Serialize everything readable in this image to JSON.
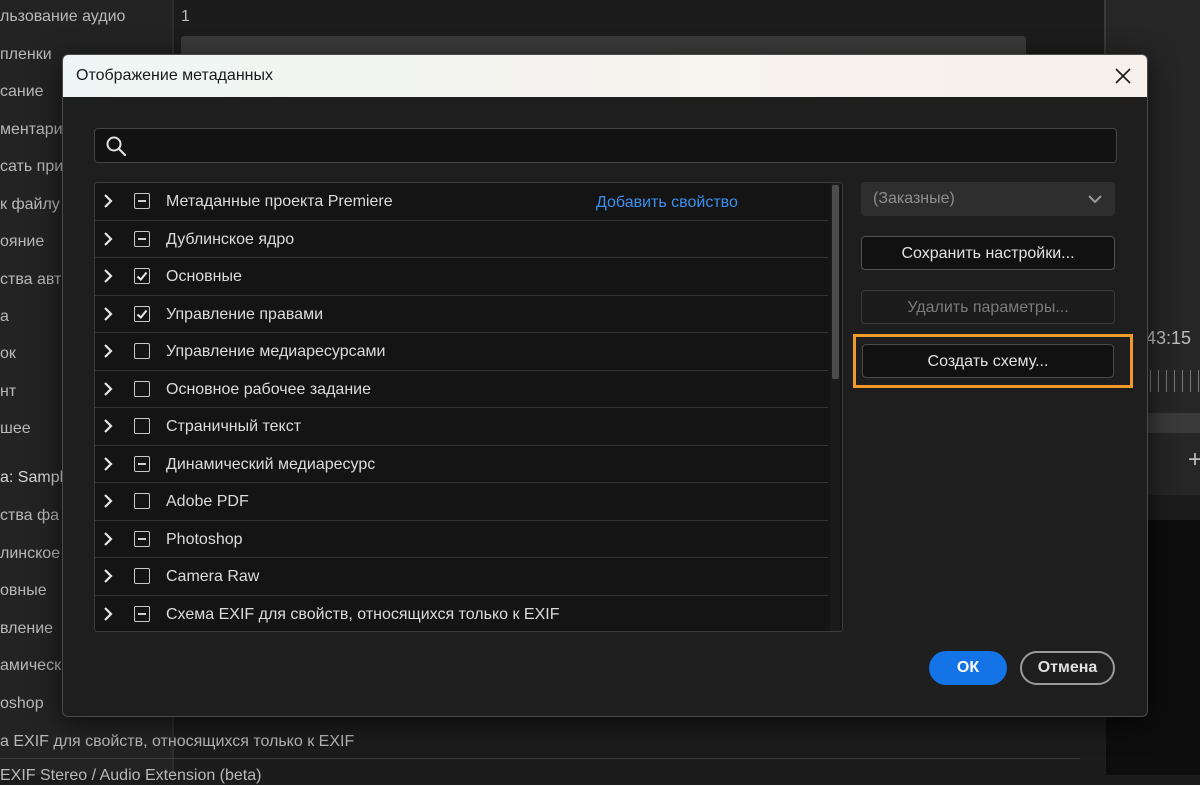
{
  "background": {
    "labels": [
      "льзование аудио",
      "пленки",
      "сание",
      "ментарий",
      "сать при",
      "к файлу",
      "ояние",
      "ства авто",
      "а",
      "ок",
      "нт",
      "шее",
      "а:  Sampl",
      "ства фа",
      "линское",
      "овные",
      "вление",
      "амически",
      "oshop",
      "а EXIF для свойств, относящихся только к EXIF",
      "EXIF Stereo / Audio Extension (beta)"
    ],
    "audio_value": "1",
    "timecode": "43:15",
    "plus_icon": "+"
  },
  "dialog": {
    "title": "Отображение метаданных",
    "search": {
      "placeholder": ""
    },
    "tree": {
      "add_property_label": "Добавить свойство",
      "rows": [
        {
          "label": "Метаданные проекта Premiere",
          "state": "mixed"
        },
        {
          "label": "Дублинское ядро",
          "state": "mixed"
        },
        {
          "label": "Основные",
          "state": "checked"
        },
        {
          "label": "Управление правами",
          "state": "checked"
        },
        {
          "label": "Управление медиаресурсами",
          "state": "unchecked"
        },
        {
          "label": "Основное рабочее задание",
          "state": "unchecked"
        },
        {
          "label": "Страничный текст",
          "state": "unchecked"
        },
        {
          "label": "Динамический медиаресурс",
          "state": "mixed"
        },
        {
          "label": "Adobe PDF",
          "state": "unchecked"
        },
        {
          "label": "Photoshop",
          "state": "mixed"
        },
        {
          "label": "Camera Raw",
          "state": "unchecked"
        },
        {
          "label": "Схема EXIF для свойств, относящихся только к EXIF",
          "state": "mixed"
        }
      ]
    },
    "preset": {
      "value": "(Заказные)"
    },
    "buttons": {
      "save": "Сохранить настройки...",
      "delete": "Удалить параметры...",
      "create": "Создать схему...",
      "ok": "ОК",
      "cancel": "Отмена"
    },
    "colors": {
      "accent": "#1473e6",
      "highlight": "#f09a2a",
      "link": "#3a8ff0"
    }
  }
}
